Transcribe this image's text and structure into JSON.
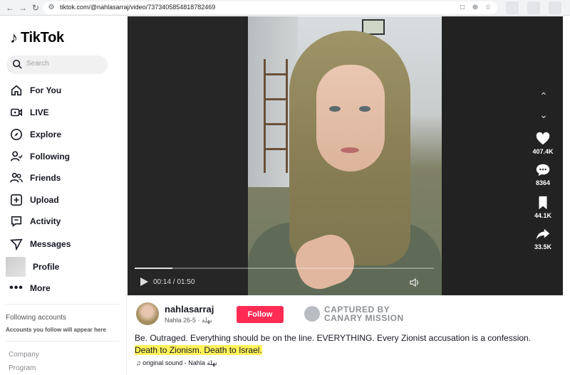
{
  "browser": {
    "url": "tiktok.com/@nahlasarraj/video/7373405854818782469"
  },
  "sidebar": {
    "logo": "TikTok",
    "search_placeholder": "Search",
    "items": [
      {
        "label": "For You",
        "icon": "home-icon"
      },
      {
        "label": "LIVE",
        "icon": "live-icon"
      },
      {
        "label": "Explore",
        "icon": "compass-icon"
      },
      {
        "label": "Following",
        "icon": "following-icon"
      },
      {
        "label": "Friends",
        "icon": "friends-icon"
      },
      {
        "label": "Upload",
        "icon": "upload-icon"
      },
      {
        "label": "Activity",
        "icon": "activity-icon"
      },
      {
        "label": "Messages",
        "icon": "messages-icon"
      },
      {
        "label": "Profile",
        "icon": "avatar"
      },
      {
        "label": "More",
        "icon": "more-icon"
      }
    ],
    "following_title": "Following accounts",
    "following_sub": "Accounts you follow will appear here",
    "footer": [
      "Company",
      "Program"
    ]
  },
  "player": {
    "time": "00:14 / 01:50",
    "progress": 0.127
  },
  "actions": {
    "likes": "407.4K",
    "comments": "8364",
    "saves": "44.1K",
    "shares": "33.5K"
  },
  "author": {
    "username": "nahlasarraj",
    "display": "Nahla نهلة · 5-26",
    "follow_label": "Follow"
  },
  "watermark": {
    "line1": "CAPTURED BY",
    "line2": "CANARY MISSION"
  },
  "caption": {
    "text": "Be. Outraged. Everything should be on the line. EVERYTHING. Every Zionist accusation is a confession. ",
    "highlight": "Death to Zionism. Death to Israel."
  },
  "sound": "original sound - Nahla نهلة",
  "colors": {
    "accent": "#fe2c55",
    "highlight": "#fff25a"
  }
}
